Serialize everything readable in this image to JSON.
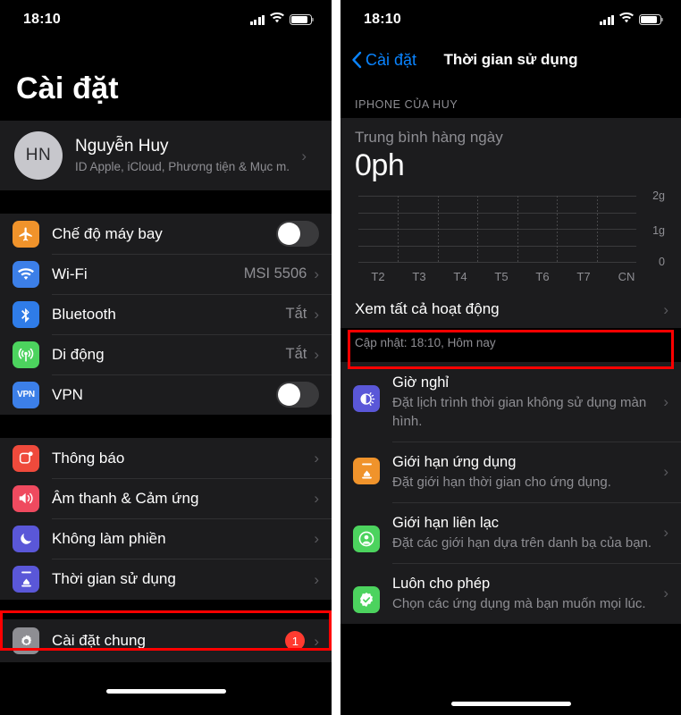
{
  "status_bar": {
    "time": "18:10",
    "signal_icon": "cellular-bars-icon",
    "wifi_icon": "wifi-icon",
    "battery_icon": "battery-icon"
  },
  "left_screen": {
    "title": "Cài đặt",
    "account": {
      "initials": "HN",
      "name": "Nguyễn Huy",
      "subtitle": "ID Apple, iCloud, Phương tiện & Mục m..."
    },
    "group1": [
      {
        "label": "Chế độ máy bay",
        "icon": "airplane-icon",
        "icon_color": "#f0932b",
        "control": "toggle",
        "toggle_on": false
      },
      {
        "label": "Wi-Fi",
        "icon": "wifi-icon",
        "icon_color": "#3c7fe8",
        "control": "value",
        "value": "MSI 5506"
      },
      {
        "label": "Bluetooth",
        "icon": "bluetooth-icon",
        "icon_color": "#2f7ce8",
        "control": "value",
        "value": "Tắt"
      },
      {
        "label": "Di động",
        "icon": "cellular-icon",
        "icon_color": "#4cd35e",
        "control": "value",
        "value": "Tắt"
      },
      {
        "label": "VPN",
        "icon": "vpn-icon",
        "icon_color": "#3c7fe8",
        "control": "toggle",
        "toggle_on": false
      }
    ],
    "group2": [
      {
        "label": "Thông báo",
        "icon": "notifications-icon",
        "icon_color": "#ef4a3c",
        "highlighted": false
      },
      {
        "label": "Âm thanh & Cảm ứng",
        "icon": "sound-icon",
        "icon_color": "#ef4a5f",
        "highlighted": false
      },
      {
        "label": "Không làm phiền",
        "icon": "moon-icon",
        "icon_color": "#5a57d8",
        "highlighted": false
      },
      {
        "label": "Thời gian sử dụng",
        "icon": "hourglass-icon",
        "icon_color": "#5a57d8",
        "highlighted": true
      }
    ],
    "group3": [
      {
        "label": "Cài đặt chung",
        "icon": "gear-icon",
        "icon_color": "#8e8e93",
        "badge": "1"
      }
    ],
    "highlight_color": "#ff0000"
  },
  "right_screen": {
    "back_label": "Cài đặt",
    "nav_title": "Thời gian sử dụng",
    "section_header": "IPHONE CỦA HUY",
    "average_label": "Trung bình hàng ngày",
    "average_value": "0ph",
    "see_all_label": "Xem tất cả hoạt động",
    "see_all_highlighted": true,
    "updated_text": "Cập nhật: 18:10, Hôm nay",
    "features": [
      {
        "title": "Giờ nghỉ",
        "desc": "Đặt lịch trình thời gian không sử dụng màn hình.",
        "icon": "bedtime-icon",
        "icon_color": "#5a57d8"
      },
      {
        "title": "Giới hạn ứng dụng",
        "desc": "Đặt giới hạn thời gian cho ứng dụng.",
        "icon": "hourglass-icon",
        "icon_color": "#f0932b"
      },
      {
        "title": "Giới hạn liên lạc",
        "desc": "Đặt các giới hạn dựa trên danh bạ của bạn.",
        "icon": "person-circle-icon",
        "icon_color": "#4cd35e"
      },
      {
        "title": "Luôn cho phép",
        "desc": "Chọn các ứng dụng mà bạn muốn mọi lúc.",
        "icon": "check-badge-icon",
        "icon_color": "#4cd35e"
      }
    ]
  },
  "chart_data": {
    "type": "bar",
    "title": "Trung bình hàng ngày",
    "categories": [
      "T2",
      "T3",
      "T4",
      "T5",
      "T6",
      "T7",
      "CN"
    ],
    "values": [
      0,
      0,
      0,
      0,
      0,
      0,
      0
    ],
    "ytick_labels": [
      "0",
      "1g",
      "2g"
    ],
    "ytick_values": [
      0,
      1,
      2
    ],
    "ylim": [
      0,
      2
    ],
    "xlabel": "",
    "ylabel": "",
    "grid": true,
    "legend": "none"
  }
}
